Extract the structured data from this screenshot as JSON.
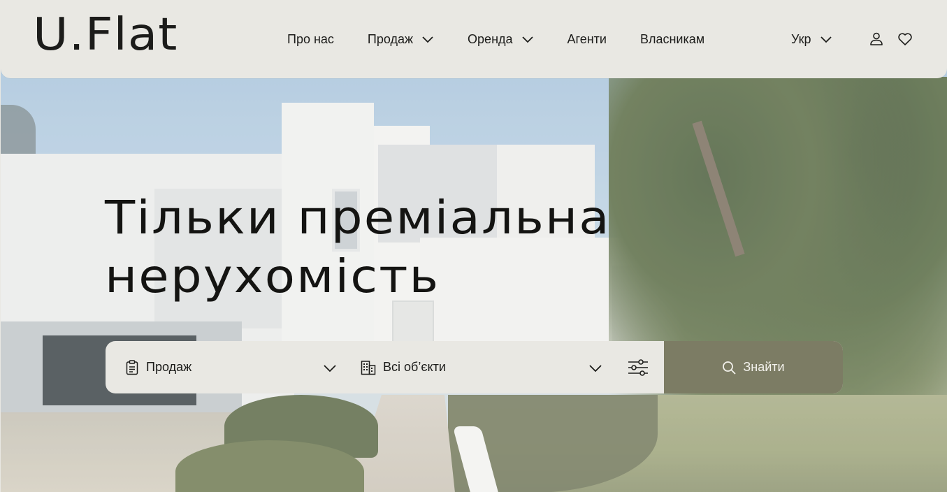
{
  "brand": {
    "logo_text": "U.Flat"
  },
  "nav": {
    "items": [
      {
        "label": "Про нас",
        "has_dropdown": false
      },
      {
        "label": "Продаж",
        "has_dropdown": true
      },
      {
        "label": "Оренда",
        "has_dropdown": true
      },
      {
        "label": "Агенти",
        "has_dropdown": false
      },
      {
        "label": "Власникам",
        "has_dropdown": false
      }
    ]
  },
  "header_actions": {
    "language": "Укр",
    "user_icon": "user-icon",
    "favorites_icon": "heart-icon"
  },
  "hero": {
    "headline_line1": "Тільки преміальна",
    "headline_line2": "нерухомість"
  },
  "search": {
    "deal_type": {
      "value": "Продаж",
      "icon": "clipboard-icon"
    },
    "property_type": {
      "value": "Всі об’єкти",
      "icon": "building-icon"
    },
    "filters_icon": "sliders-icon",
    "submit_label": "Знайти",
    "submit_icon": "search-icon"
  },
  "colors": {
    "header_bg": "#e9e8e3",
    "text": "#1c1c1a",
    "accent_button": "#7c7c64",
    "button_text": "#f3f2ec"
  }
}
